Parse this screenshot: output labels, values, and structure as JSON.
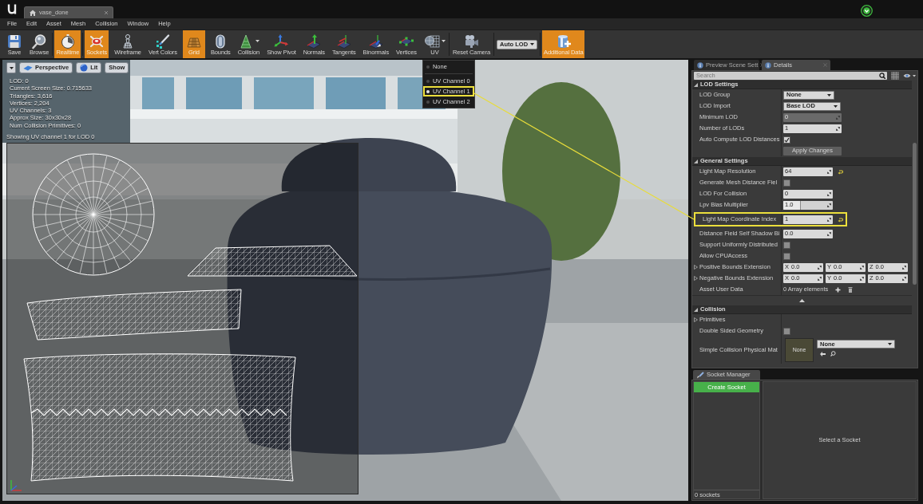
{
  "title_bar": {
    "document_tab": "vase_done"
  },
  "menu": [
    "File",
    "Edit",
    "Asset",
    "Mesh",
    "Collision",
    "Window",
    "Help"
  ],
  "toolbar": {
    "groups": [
      {
        "items": [
          {
            "kind": "button",
            "label": "Save",
            "on": false
          },
          {
            "kind": "button",
            "label": "Browse",
            "on": false
          }
        ]
      },
      {
        "items": [
          {
            "kind": "button",
            "label": "Realtime",
            "on": true
          }
        ]
      },
      {
        "items": [
          {
            "kind": "button",
            "label": "Sockets",
            "on": true
          },
          {
            "kind": "button",
            "label": "Wireframe",
            "on": false
          },
          {
            "kind": "button",
            "label": "Vert Colors",
            "on": false
          },
          {
            "kind": "button",
            "label": "Grid",
            "on": true
          },
          {
            "kind": "button",
            "label": "Bounds",
            "on": false
          },
          {
            "kind": "dropdown",
            "label": "Collision",
            "on": false
          },
          {
            "kind": "button",
            "label": "Show Pivot",
            "on": false
          },
          {
            "kind": "button",
            "label": "Normals",
            "on": false
          },
          {
            "kind": "button",
            "label": "Tangents",
            "on": false
          },
          {
            "kind": "button",
            "label": "Binormals",
            "on": false
          },
          {
            "kind": "button",
            "label": "Vertices",
            "on": false
          },
          {
            "kind": "dropdown",
            "label": "UV",
            "on": false,
            "menu": {
              "sections": [
                [
                  {
                    "label": "None",
                    "selected": false,
                    "highlighted": false
                  }
                ],
                [
                  {
                    "label": "UV Channel 0",
                    "selected": false,
                    "highlighted": false
                  },
                  {
                    "label": "UV Channel 1",
                    "selected": true,
                    "highlighted": true
                  },
                  {
                    "label": "UV Channel 2",
                    "selected": false,
                    "highlighted": false
                  }
                ]
              ]
            }
          }
        ]
      },
      {
        "items": [
          {
            "kind": "button",
            "label": "Reset Camera",
            "on": false
          }
        ]
      },
      {
        "items": [
          {
            "kind": "combo",
            "label": "Auto LOD"
          }
        ]
      },
      {
        "items": [
          {
            "kind": "button",
            "label": "Additional Data",
            "on": true
          }
        ]
      }
    ]
  },
  "viewport": {
    "buttons": [
      {
        "label": "Perspective"
      },
      {
        "label": "Lit"
      },
      {
        "label": "Show"
      }
    ],
    "stats": [
      "LOD: 0",
      "Current Screen Size: 0.715633",
      "Triangles: 3,616",
      "Vertices: 2,204",
      "UV Channels: 3",
      "Approx Size: 30x30x28",
      "Num Collision Primitives: 0"
    ],
    "status": "Showing UV channel 1 for LOD 0"
  },
  "details": {
    "tabs": [
      {
        "label": "Preview Scene Sett",
        "selected": false
      },
      {
        "label": "Details",
        "selected": true
      }
    ],
    "search": {
      "placeholder": "Search"
    },
    "categories": [
      {
        "title": "LOD Settings",
        "expanded": true,
        "rows": [
          {
            "kind": "dropdown",
            "label": "LOD Group",
            "value": "None"
          },
          {
            "kind": "dropdown",
            "label": "LOD Import",
            "value": "Base LOD"
          },
          {
            "kind": "number",
            "label": "Minimum LOD",
            "value": "0",
            "disabled": true
          },
          {
            "kind": "number",
            "label": "Number of LODs",
            "value": "1",
            "disabled": false
          },
          {
            "kind": "checkbox",
            "label": "Auto Compute LOD Distances",
            "checked": true
          },
          {
            "kind": "button",
            "button": "Apply Changes",
            "disabled": true
          }
        ]
      },
      {
        "title": "General Settings",
        "expanded": true,
        "advanced_expanded": true,
        "rows": [
          {
            "kind": "number",
            "label": "Light Map Resolution",
            "value": "64",
            "disabled": false,
            "reset": true
          },
          {
            "kind": "checkbox",
            "label": "Generate Mesh Distance Fiel",
            "checked": false
          },
          {
            "kind": "number",
            "label": "LOD For Collision",
            "value": "0",
            "disabled": false
          },
          {
            "kind": "slider",
            "label": "Lpv Bias Multiplier",
            "value": "1.0",
            "level": 0.35
          },
          {
            "kind": "number",
            "label": "Light Map Coordinate Index",
            "value": "1",
            "disabled": false,
            "reset": true,
            "highlighted": true
          },
          {
            "kind": "number",
            "label": "Distance Field Self Shadow Bi",
            "value": "0.0",
            "disabled": false
          },
          {
            "kind": "checkbox",
            "label": "Support Uniformly Distributed",
            "checked": false
          },
          {
            "kind": "checkbox",
            "label": "Allow CPUAccess",
            "checked": false
          },
          {
            "kind": "vector",
            "label": "Positive Bounds Extension",
            "expanded": false,
            "components": [
              {
                "axis": "X",
                "value": "0.0"
              },
              {
                "axis": "Y",
                "value": "0.0"
              },
              {
                "axis": "Z",
                "value": "0.0"
              }
            ]
          },
          {
            "kind": "vector",
            "label": "Negative Bounds Extension",
            "expanded": false,
            "components": [
              {
                "axis": "X",
                "value": "0.0"
              },
              {
                "axis": "Y",
                "value": "0.0"
              },
              {
                "axis": "Z",
                "value": "0.0"
              }
            ]
          },
          {
            "kind": "array",
            "label": "Asset User Data",
            "value": "0 Array elements"
          }
        ]
      },
      {
        "title": "Collision",
        "expanded": true,
        "rows": [
          {
            "kind": "group",
            "label": "Primitives",
            "expanded": false
          },
          {
            "kind": "checkbox",
            "label": "Double Sided Geometry",
            "checked": false
          },
          {
            "kind": "asset",
            "label": "Simple Collision Physical Mat",
            "thumbnail": "None",
            "value": "None"
          }
        ]
      }
    ]
  },
  "socket_manager": {
    "tab": "Socket Manager",
    "create_button": "Create Socket",
    "count": "0 sockets",
    "empty_text": "Select a Socket"
  }
}
